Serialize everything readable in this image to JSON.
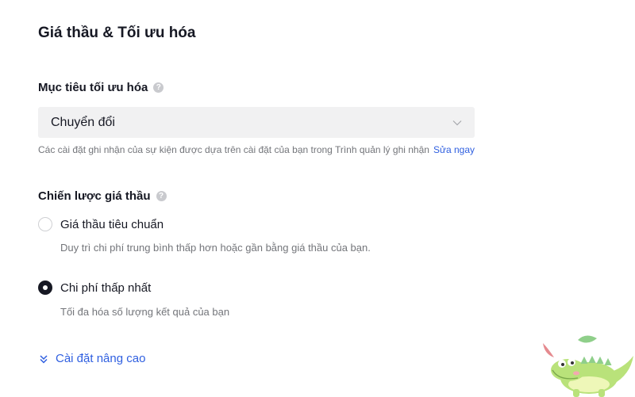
{
  "section_title": "Giá thầu & Tối ưu hóa",
  "optimization_goal": {
    "label": "Mục tiêu tối ưu hóa",
    "selected_value": "Chuyển đổi",
    "hint": "Các cài đặt ghi nhận của sự kiện được dựa trên cài đặt của bạn trong Trình quản lý ghi nhận",
    "hint_link": "Sửa ngay"
  },
  "bid_strategy": {
    "label": "Chiến lược giá thầu",
    "options": [
      {
        "label": "Giá thầu tiêu chuẩn",
        "description": "Duy trì chi phí trung bình thấp hơn hoặc gần bằng giá thầu của bạn.",
        "selected": false
      },
      {
        "label": "Chi phí thấp nhất",
        "description": "Tối đa hóa số lượng kết quả của bạn",
        "selected": true
      }
    ]
  },
  "advanced_settings": {
    "label": "Cài đặt nâng cao"
  },
  "colors": {
    "accent": "#2f5fe0",
    "text": "#161823",
    "muted": "#73757a",
    "field_bg": "#f1f1f2"
  }
}
